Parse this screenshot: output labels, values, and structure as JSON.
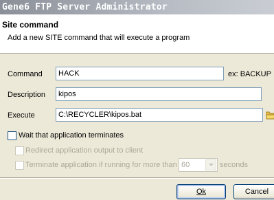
{
  "window": {
    "title": "Gene6 FTP Server Administrator"
  },
  "header": {
    "title": "Site command",
    "description": "Add a new SITE command that will execute a program"
  },
  "form": {
    "command": {
      "label": "Command",
      "value": "HACK",
      "hint": "ex: BACKUP"
    },
    "description": {
      "label": "Description",
      "value": "kipos"
    },
    "execute": {
      "label": "Execute",
      "value": "C:\\RECYCLER\\kipos.bat",
      "browse_icon": "folder-icon"
    }
  },
  "options": {
    "wait": {
      "label": "Wait that application terminates",
      "checked": false,
      "enabled": true
    },
    "redirect": {
      "label": "Redirect application output to client",
      "checked": false,
      "enabled": false
    },
    "terminate": {
      "label": "Terminate application if running for more than",
      "checked": false,
      "enabled": false,
      "timeout_value": "60",
      "unit": "seconds"
    }
  },
  "buttons": {
    "ok": "Ok",
    "cancel": "Cancel"
  },
  "colors": {
    "field_border": "#7f9db9",
    "dialog_bg": "#ece9d8",
    "disabled_text": "#aca899"
  }
}
